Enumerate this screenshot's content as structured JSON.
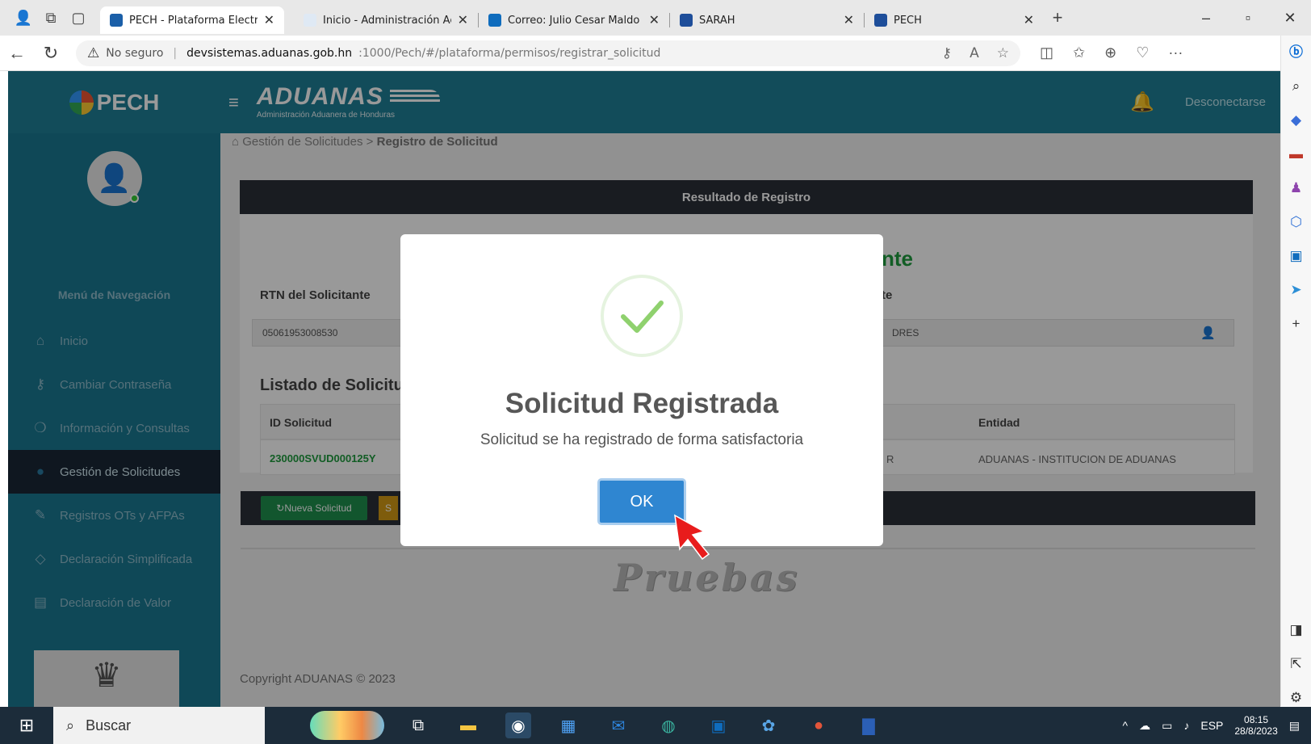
{
  "browser": {
    "tabs": [
      {
        "title": "PECH - Plataforma Electró",
        "active": true
      },
      {
        "title": "Inicio - Administración Ac",
        "active": false
      },
      {
        "title": "Correo: Julio Cesar Maldo",
        "active": false
      },
      {
        "title": "SARAH",
        "active": false
      },
      {
        "title": "PECH",
        "active": false
      }
    ],
    "security": "No seguro",
    "url_host": "devsistemas.aduanas.gob.hn",
    "url_path": ":1000/Pech/#/plataforma/permisos/registrar_solicitud"
  },
  "header": {
    "brand": "PECH",
    "aduanas": "ADUANAS",
    "aduanas_sub": "Administración Aduanera de Honduras",
    "logout": "Desconectarse"
  },
  "sidebar": {
    "nav_title": "Menú de Navegación",
    "items": [
      {
        "label": "Inicio",
        "icon": "home-icon"
      },
      {
        "label": "Cambiar Contraseña",
        "icon": "key-icon"
      },
      {
        "label": "Información y Consultas",
        "icon": "chat-icon"
      },
      {
        "label": "Gestión de Solicitudes",
        "icon": "globe-icon",
        "active": true
      },
      {
        "label": "Registros OTs y AFPAs",
        "icon": "edit-icon"
      },
      {
        "label": "Declaración Simplificada",
        "icon": "tag-icon"
      },
      {
        "label": "Declaración de Valor",
        "icon": "briefcase-icon"
      }
    ]
  },
  "main": {
    "breadcrumb_root": "Gestión de Solicitudes",
    "breadcrumb_current": "Registro de Solicitud",
    "panel_title": "Resultado de Registro",
    "green_heading_fragment": "nte",
    "rtn_label": "RTN del Solicitante",
    "rtn_value": "05061953008530",
    "name_label_fragment": "te",
    "name_value_fragment": "DRES",
    "list_title": "Listado de Solicitu",
    "col_id": "ID Solicitud",
    "col_entidad": "Entidad",
    "row_id": "230000SVUD000125Y",
    "row_mid_fragment": "R",
    "row_entidad": "ADUANAS - INSTITUCION DE ADUANAS",
    "btn_new": "Nueva Solicitud",
    "btn_second_fragment": "S",
    "watermark": "Pruebas",
    "footer": "Copyright ADUANAS © 2023"
  },
  "modal": {
    "title": "Solicitud Registrada",
    "text": "Solicitud se ha registrado de forma satisfactoria",
    "ok": "OK",
    "success_color": "#8fd16e"
  },
  "taskbar": {
    "search": "Buscar",
    "lang": "ESP",
    "time": "08:15",
    "date": "28/8/2023"
  },
  "colors": {
    "header": "#1e7f97",
    "sidebar": "#1a7892",
    "dark_bar": "#2a2f38",
    "ok_button": "#2f86d1"
  }
}
